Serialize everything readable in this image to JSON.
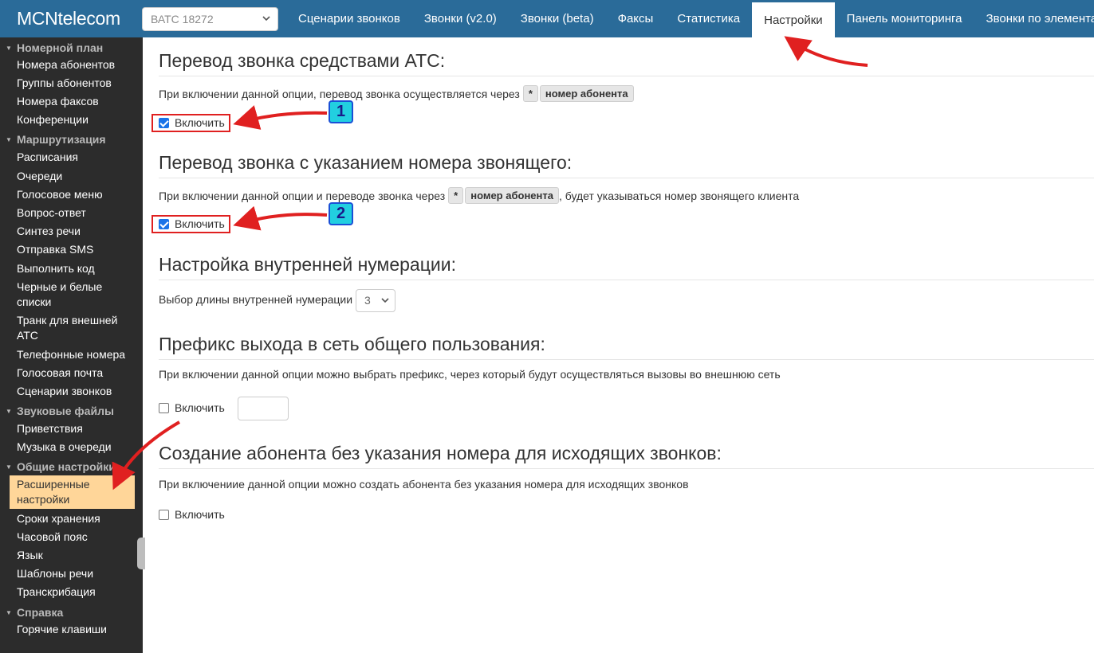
{
  "header": {
    "brand": "MCNtelecom",
    "vats_select_value": "ВАТС 18272",
    "tabs": [
      {
        "label": "Сценарии звонков"
      },
      {
        "label": "Звонки (v2.0)"
      },
      {
        "label": "Звонки (beta)"
      },
      {
        "label": "Факсы"
      },
      {
        "label": "Статистика"
      },
      {
        "label": "Настройки",
        "active": true
      },
      {
        "label": "Панель мониторинга"
      },
      {
        "label": "Звонки по элементам"
      }
    ]
  },
  "sidebar": {
    "sections": [
      {
        "label": "Номерной план",
        "items": [
          "Номера абонентов",
          "Группы абонентов",
          "Номера факсов",
          "Конференции"
        ]
      },
      {
        "label": "Маршрутизация",
        "items": [
          "Расписания",
          "Очереди",
          "Голосовое меню",
          "Вопрос-ответ",
          "Синтез речи",
          "Отправка SMS",
          "Выполнить код",
          "Черные и белые списки",
          "Транк для внешней АТС",
          "Телефонные номера",
          "Голосовая почта",
          "Сценарии звонков"
        ]
      },
      {
        "label": "Звуковые файлы",
        "items": [
          "Приветствия",
          "Музыка в очереди"
        ]
      },
      {
        "label": "Общие настройки",
        "items": [
          "Расширенные настройки",
          "Сроки хранения",
          "Часовой пояс",
          "Язык",
          "Шаблоны речи",
          "Транскрибация"
        ]
      },
      {
        "label": "Справка",
        "items": [
          "Горячие клавиши"
        ]
      }
    ],
    "active_item": "Расширенные настройки"
  },
  "main": {
    "transfer_pbx": {
      "title": "Перевод звонка средствами АТС:",
      "desc": "При включении данной опции, перевод звонка осуществляется через",
      "key_star": "*",
      "key_number": "номер абонента",
      "checkbox_label": "Включить",
      "checked": true
    },
    "transfer_caller": {
      "title": "Перевод звонка с указанием номера звонящего:",
      "desc_before": "При включении данной опции и переводе звонка через",
      "key_star": "*",
      "key_number": "номер абонента",
      "desc_after": ", будет указываться номер звонящего клиента",
      "checkbox_label": "Включить",
      "checked": true
    },
    "internal_numbering": {
      "title": "Настройка внутренней нумерации:",
      "label": "Выбор длины внутренней нумерации",
      "value": "3"
    },
    "exit_prefix": {
      "title": "Префикс выхода в сеть общего пользования:",
      "desc": "При включении данной опции можно выбрать префикс, через который будут осуществляться вызовы во внешнюю сеть",
      "checkbox_label": "Включить",
      "checked": false,
      "prefix_value": ""
    },
    "no_number_subscriber": {
      "title": "Создание абонента без указания номера для исходящих звонков:",
      "desc": "При включениие данной опции можно создать абонента без указания номера для исходящих звонков",
      "checkbox_label": "Включить",
      "checked": false
    }
  },
  "annotations": {
    "badge_1": "1",
    "badge_2": "2",
    "arrow_color": "#e02020"
  }
}
